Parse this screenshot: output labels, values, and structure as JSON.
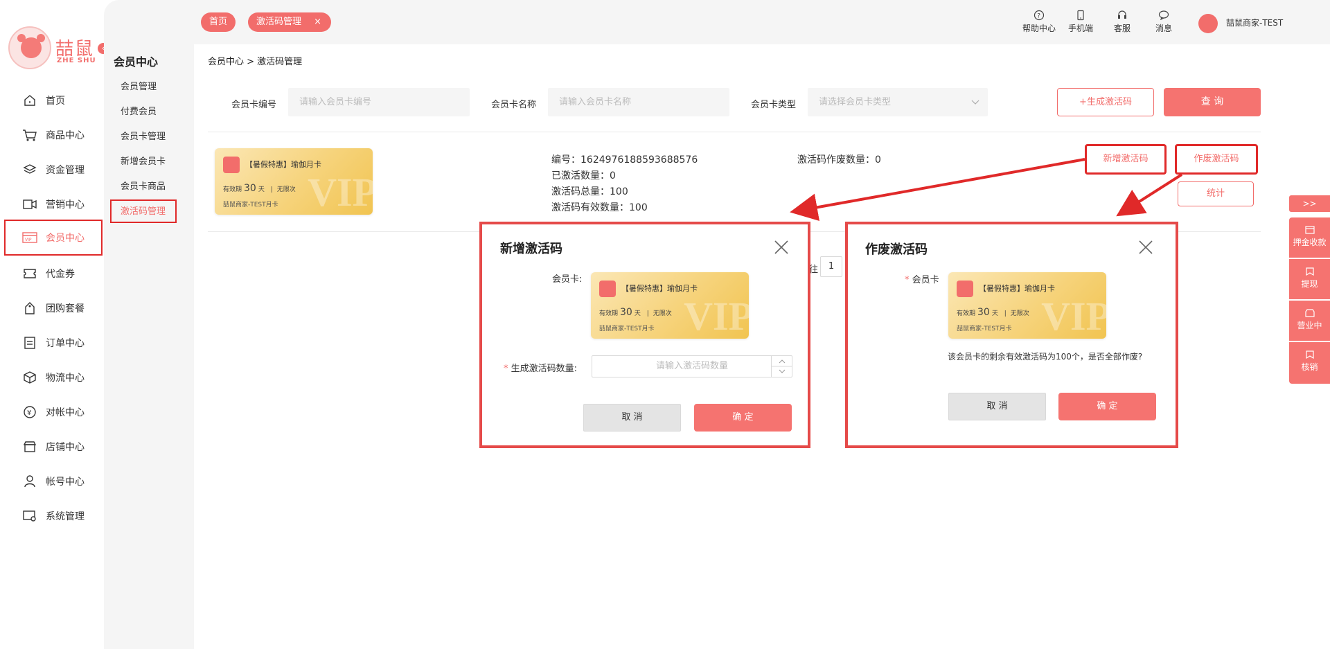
{
  "logo": {
    "title": "喆鼠",
    "subtitle": "ZHE SHU"
  },
  "sidebar": {
    "items": [
      {
        "label": "首页"
      },
      {
        "label": "商品中心"
      },
      {
        "label": "资金管理"
      },
      {
        "label": "营销中心"
      },
      {
        "label": "会员中心"
      },
      {
        "label": "代金券"
      },
      {
        "label": "团购套餐"
      },
      {
        "label": "订单中心"
      },
      {
        "label": "物流中心"
      },
      {
        "label": "对帐中心"
      },
      {
        "label": "店铺中心"
      },
      {
        "label": "帐号中心"
      },
      {
        "label": "系统管理"
      }
    ]
  },
  "subsidebar": {
    "title": "会员中心",
    "items": [
      {
        "label": "会员管理"
      },
      {
        "label": "付费会员"
      },
      {
        "label": "会员卡管理"
      },
      {
        "label": "新增会员卡"
      },
      {
        "label": "会员卡商品"
      },
      {
        "label": "激活码管理"
      }
    ]
  },
  "topbar": {
    "tabs": [
      {
        "label": "首页"
      },
      {
        "label": "激活码管理",
        "close": "×"
      }
    ],
    "utils": [
      {
        "label": "帮助中心",
        "icon": "help-icon"
      },
      {
        "label": "手机端",
        "icon": "phone-icon"
      },
      {
        "label": "客服",
        "icon": "headset-icon"
      },
      {
        "label": "消息",
        "icon": "chat-icon"
      }
    ],
    "user": "喆鼠商家-TEST"
  },
  "breadcrumb": "会员中心 > 激活码管理",
  "filters": {
    "card_no_label": "会员卡编号",
    "card_no_placeholder": "请输入会员卡编号",
    "card_name_label": "会员卡名称",
    "card_name_placeholder": "请输入会员卡名称",
    "card_type_label": "会员卡类型",
    "card_type_placeholder": "请选择会员卡类型",
    "generate_label": "+生成激活码",
    "query_label": "查 询"
  },
  "card": {
    "name": "【暑假特惠】瑜伽月卡",
    "valid_prefix": "有效期",
    "valid_days": "30",
    "valid_unit": "天",
    "valid_sep": "|",
    "valid_times": "无限次",
    "store": "喆鼠商家-TEST月卡",
    "watermark": "VIP",
    "badge": "喆鼠"
  },
  "record": {
    "number": "编号：1624976188593688576",
    "activated": "已激活数量：0",
    "total": "激活码总量：100",
    "valid_count": "激活码有效数量：100",
    "voided": "激活码作废数量：0",
    "add_btn": "新增激活码",
    "void_btn": "作废激活码",
    "stats_btn": "统计"
  },
  "pagination": {
    "prefix": "往",
    "page": "1"
  },
  "modal_add": {
    "title": "新增激活码",
    "card_label": "会员卡:",
    "qty_label": "生成激活码数量:",
    "qty_required": "*",
    "qty_placeholder": "请输入激活码数量",
    "cancel": "取 消",
    "confirm": "确 定"
  },
  "modal_void": {
    "title": "作废激活码",
    "card_label": "会员卡",
    "card_required": "*",
    "message": "该会员卡的剩余有效激活码为100个，是否全部作废?",
    "cancel": "取 消",
    "confirm": "确 定"
  },
  "float_panel": {
    "toggle": ">>",
    "items": [
      {
        "label": "押金收款"
      },
      {
        "label": "提现"
      },
      {
        "label": "营业中"
      },
      {
        "label": "核销"
      }
    ]
  },
  "colors": {
    "accent": "#f26d6b",
    "highlight_box": "#e02929"
  }
}
